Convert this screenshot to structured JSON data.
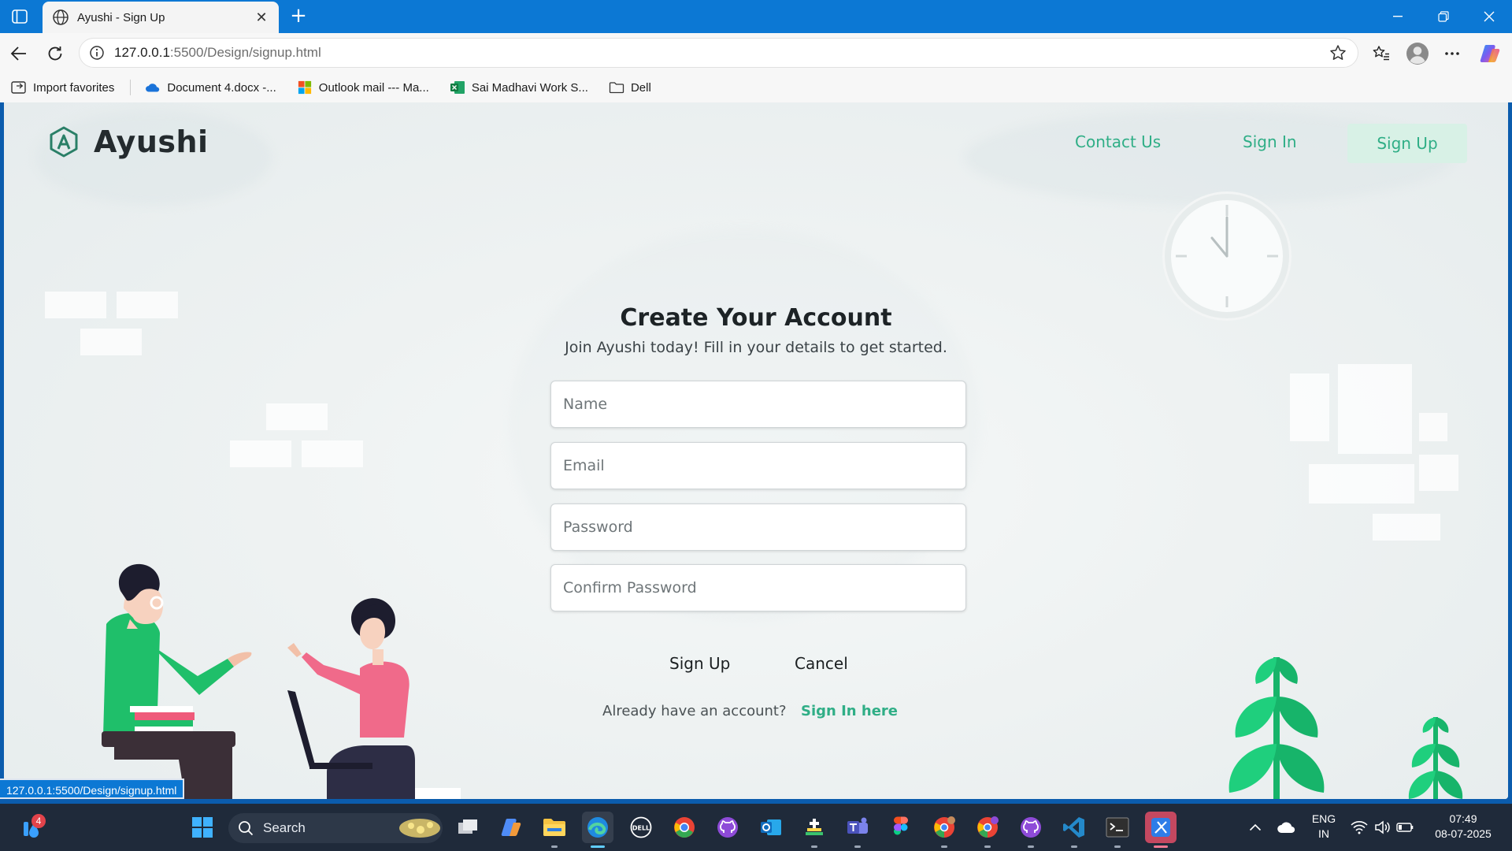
{
  "browser": {
    "tab_title": "Ayushi - Sign Up",
    "url_host": "127.0.0.1",
    "url_path": ":5500/Design/signup.html",
    "favorites": [
      {
        "label": "Import favorites",
        "icon": "import-icon"
      },
      {
        "label": "Document 4.docx -...",
        "icon": "onedrive-icon"
      },
      {
        "label": "Outlook mail --- Ma...",
        "icon": "microsoft-icon"
      },
      {
        "label": "Sai Madhavi Work S...",
        "icon": "excel-icon"
      },
      {
        "label": "Dell",
        "icon": "folder-icon"
      }
    ],
    "status_url": "127.0.0.1:5500/Design/signup.html"
  },
  "page": {
    "brand": "Ayushi",
    "nav": {
      "contact": "Contact Us",
      "signin": "Sign In",
      "signup": "Sign Up"
    },
    "form": {
      "title": "Create Your Account",
      "subtitle": "Join Ayushi today! Fill in your details to get started.",
      "name_placeholder": "Name",
      "email_placeholder": "Email",
      "password_placeholder": "Password",
      "confirm_placeholder": "Confirm Password",
      "submit_label": "Sign Up",
      "cancel_label": "Cancel",
      "already_text": "Already have an account?",
      "signin_link": "Sign In here"
    },
    "colors": {
      "accent": "#2fae86",
      "accent_soft": "#d8f1e6",
      "background": "#eef2f3"
    }
  },
  "taskbar": {
    "search_label": "Search",
    "notification_count": "4",
    "language_line1": "ENG",
    "language_line2": "IN",
    "time": "07:49",
    "date": "08-07-2025"
  }
}
